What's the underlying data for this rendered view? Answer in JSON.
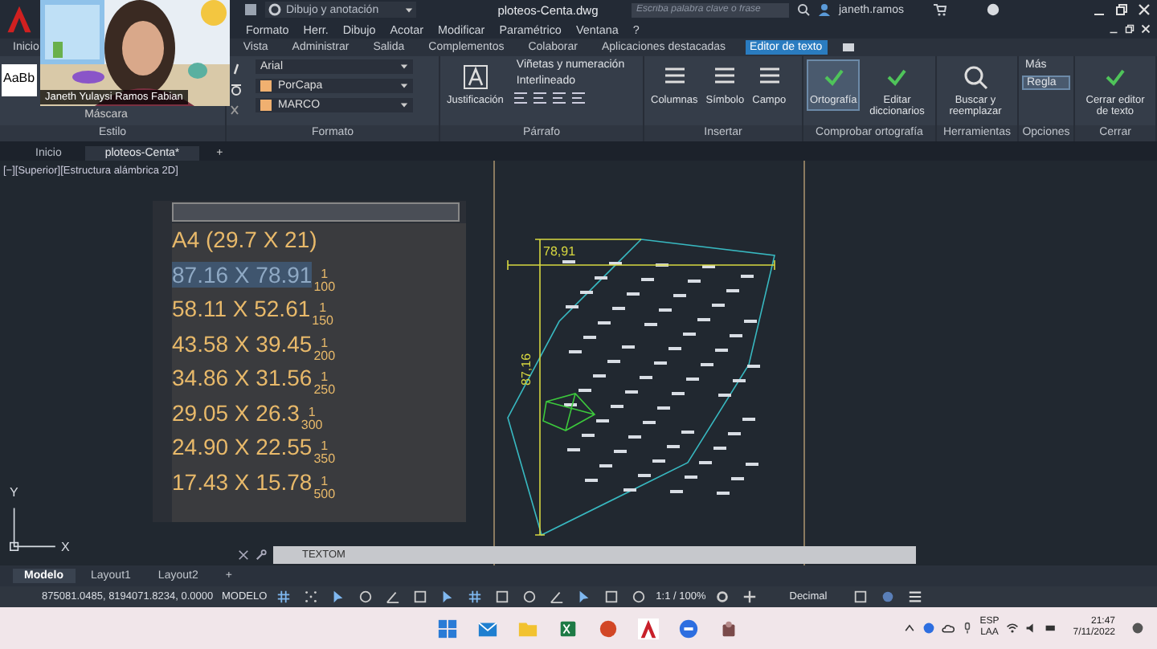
{
  "title_bar": {
    "workspace": "Dibujo y anotación",
    "file": "ploteos-Centa.dwg",
    "search": {
      "placeholder": "Escriba palabra clave o frase"
    },
    "user": "janeth.ramos"
  },
  "webcam": {
    "kind": "picture",
    "caption": "Janeth Yulaysi Ramos Fabian"
  },
  "menu": [
    "Formato",
    "Herr.",
    "Dibujo",
    "Acotar",
    "Modificar",
    "Paramétrico",
    "Ventana",
    "?"
  ],
  "ribbon_tabs": [
    {
      "label": "Inicio",
      "selected": false
    },
    {
      "label": "Vista",
      "selected": false
    },
    {
      "label": "Administrar",
      "selected": false
    },
    {
      "label": "Salida",
      "selected": false
    },
    {
      "label": "Complementos",
      "selected": false
    },
    {
      "label": "Colaborar",
      "selected": false
    },
    {
      "label": "Aplicaciones destacadas",
      "selected": false
    },
    {
      "label": "Editor de texto",
      "selected": true
    }
  ],
  "style_panel": {
    "sample": "AaBb",
    "mask": "Máscara",
    "label": "Estilo"
  },
  "format_panel": {
    "font": "Arial",
    "color_source": "PorCapa",
    "layer": "MARCO",
    "label": "Formato"
  },
  "paragraph_panel": {
    "justify": "Justificación",
    "bullets": "Viñetas y numeración",
    "spacing": "Interlineado",
    "label": "Párrafo"
  },
  "insert_panel": {
    "buttons": [
      "Columnas",
      "Símbolo",
      "Campo"
    ],
    "label": "Insertar"
  },
  "spell_panel": {
    "buttons": [
      {
        "label": "Ortografía",
        "selected": true
      },
      {
        "label": "Editar diccionarios",
        "selected": false
      }
    ],
    "label": "Comprobar ortografía"
  },
  "tools_panel": {
    "button": "Buscar y reemplazar",
    "label": "Herramientas"
  },
  "options_panel": {
    "more": "Más",
    "ruler": {
      "label": "Regla",
      "on": true
    },
    "label": "Opciones"
  },
  "close_panel": {
    "button": "Cerrar editor de texto",
    "label": "Cerrar"
  },
  "doc_tabs": [
    {
      "label": "Inicio",
      "selected": false
    },
    {
      "label": "ploteos-Centa*",
      "selected": true
    }
  ],
  "doc_add": "+",
  "viewport_label": "[−][Superior][Estructura alámbrica 2D]",
  "text_editor": {
    "lines": [
      {
        "text": "A4 (29.7 X 21)",
        "selected": false
      },
      {
        "text": "87.16 X 78.91",
        "numerator": "1",
        "denominator": "100",
        "selected": true
      },
      {
        "text": "58.11 X 52.61",
        "numerator": "1",
        "denominator": "150",
        "selected": false
      },
      {
        "text": "43.58 X 39.45",
        "numerator": "1",
        "denominator": "200",
        "selected": false
      },
      {
        "text": "34.86 X 31.56",
        "numerator": "1",
        "denominator": "250",
        "selected": false
      },
      {
        "text": "29.05 X 26.3",
        "numerator": "1",
        "denominator": "300",
        "selected": false
      },
      {
        "text": "24.90 X 22.55",
        "numerator": "1",
        "denominator": "350",
        "selected": false
      },
      {
        "text": "17.43 X 15.78",
        "numerator": "1",
        "denominator": "500",
        "selected": false
      }
    ]
  },
  "drawing": {
    "dim_horizontal": "78,91",
    "dim_vertical": "87,16"
  },
  "ucs": {
    "x": "X",
    "y": "Y"
  },
  "command_line": {
    "value": "TEXTOM"
  },
  "layout_tabs": [
    {
      "label": "Modelo",
      "selected": true
    },
    {
      "label": "Layout1",
      "selected": false
    },
    {
      "label": "Layout2",
      "selected": false
    }
  ],
  "layout_add": "+",
  "status_bar": {
    "coordinates": "875081.0485, 8194071.8234, 0.0000",
    "space": "MODELO",
    "scale": "1:1 / 100%",
    "units": "Decimal"
  },
  "taskbar": {
    "language": "ESP",
    "region": "LAA",
    "time": "21:47",
    "date": "7/11/2022"
  }
}
